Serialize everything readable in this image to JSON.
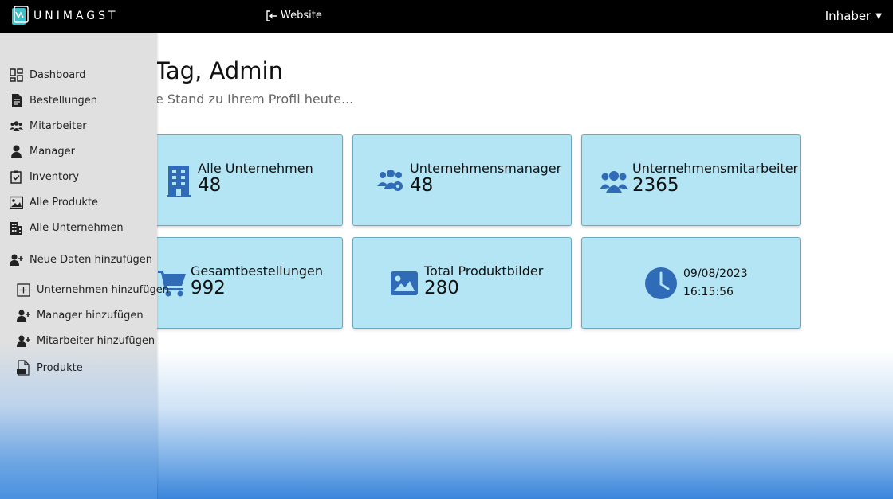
{
  "header": {
    "logo_text": "UNIMAGST",
    "website_label": "Website",
    "user_label": "Inhaber"
  },
  "colors": {
    "topbar": "#000000",
    "sidebar": "#e0e0e0",
    "card_bg": "#b3e5f4",
    "icon_blue": "#2f6bb6"
  },
  "sidebar": {
    "items": [
      {
        "label": "Dashboard",
        "icon": "dashboard-icon"
      },
      {
        "label": "Bestellungen",
        "icon": "document-icon"
      },
      {
        "label": "Mitarbeiter",
        "icon": "users-icon"
      },
      {
        "label": "Manager",
        "icon": "user-icon"
      },
      {
        "label": "Inventory",
        "icon": "clipboard-check-icon"
      },
      {
        "label": "Alle Produkte",
        "icon": "image-icon"
      },
      {
        "label": "Alle Unternehmen",
        "icon": "building-icon"
      },
      {
        "label": "Neue Daten hinzufügen",
        "icon": "user-plus-icon"
      }
    ],
    "subitems": [
      {
        "label": "Unternehmen hinzufügen",
        "icon": "plus-square-icon"
      },
      {
        "label": "Manager hinzufügen",
        "icon": "user-plus-icon"
      },
      {
        "label": "Mitarbeiter hinzufügen",
        "icon": "user-plus-icon"
      },
      {
        "label": "Produkte",
        "icon": "csv-file-icon"
      }
    ]
  },
  "main": {
    "greeting": "Tag, Admin",
    "subtext": "e Stand zu Ihrem Profil heute..."
  },
  "cards": [
    {
      "label": "Alle Unternehmen",
      "value": "48",
      "icon": "building-icon"
    },
    {
      "label": "Unternehmensmanager",
      "value": "48",
      "icon": "users-gear-icon"
    },
    {
      "label": "Unternehmensmitarbeiter",
      "value": "2365",
      "icon": "users-icon"
    },
    {
      "label": "Gesamtbestellungen",
      "value": "992",
      "icon": "cart-icon"
    },
    {
      "label": "Total Produktbilder",
      "value": "280",
      "icon": "image-icon"
    },
    {
      "date": "09/08/2023",
      "time": "16:15:56",
      "icon": "clock-icon"
    }
  ]
}
